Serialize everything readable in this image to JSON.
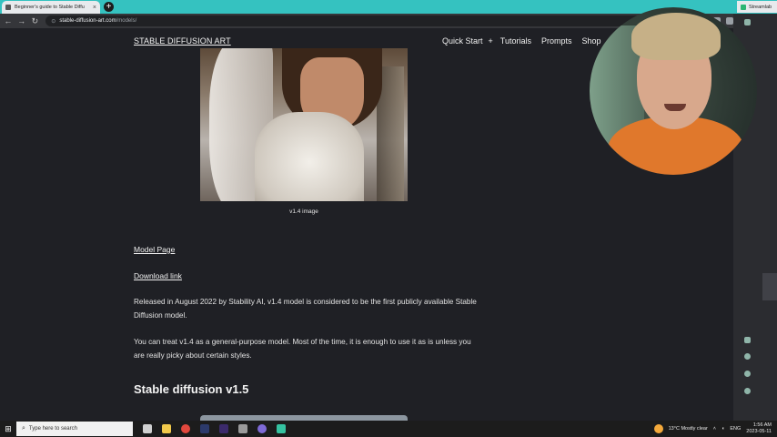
{
  "browser": {
    "tab_title": "Beginner's guide to Stable Diffu",
    "tab_close": "×",
    "new_tab": "+",
    "right_tab_title": "Streamlab",
    "url_host": "stable-diffusion-art.com",
    "url_path": "/models/",
    "back": "←",
    "forward": "→",
    "reload": "↻",
    "lock": "⊙"
  },
  "site": {
    "brand": "STABLE DIFFUSION ART",
    "nav": {
      "quick_start": "Quick Start",
      "plus": "+",
      "tutorials": "Tutorials",
      "prompts": "Prompts",
      "shop": "Shop"
    }
  },
  "content": {
    "image_caption": "v1.4 image",
    "model_page_link": "Model Page",
    "download_link": "Download link",
    "para1": "Released in August 2022 by Stability AI, v1.4 model is considered to be the first publicly available Stable Diffusion model.",
    "para2": "You can treat v1.4 as a general-purpose model. Most of the time, it is enough to use it as is unless you are really picky about certain styles.",
    "heading_v15": "Stable diffusion v1.5"
  },
  "taskbar": {
    "search_placeholder": "Type here to search",
    "weather": "13°C  Mostly clear",
    "language": "ENG",
    "time": "1:56 AM",
    "date": "2023-05-11"
  },
  "colors": {
    "page_bg": "#1f2025",
    "tabstrip": "#35c2c0",
    "text": "#f1f1f1"
  }
}
